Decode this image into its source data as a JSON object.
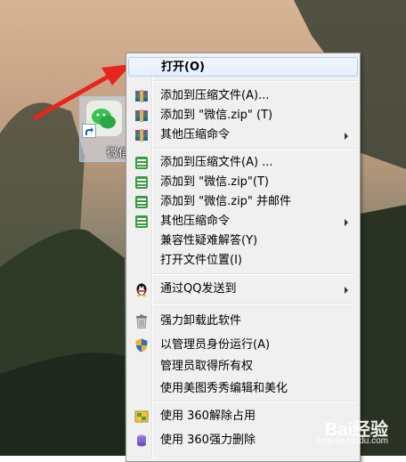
{
  "desktop": {
    "shortcut_label": "微信"
  },
  "context_menu": {
    "items": [
      {
        "label": "打开(O)",
        "icon": "none",
        "submenu": false
      },
      {
        "label": "添加到压缩文件(A)...",
        "icon": "winrar-archive-icon",
        "submenu": false
      },
      {
        "label": "添加到 \"微信.zip\" (T)",
        "icon": "winrar-archive-icon",
        "submenu": false
      },
      {
        "label": "其他压缩命令",
        "icon": "winrar-archive-icon",
        "submenu": true
      },
      {
        "label": "添加到压缩文件(A) ...",
        "icon": "archive-icon",
        "submenu": false
      },
      {
        "label": "添加到 \"微信.zip\"(T)",
        "icon": "archive-icon",
        "submenu": false
      },
      {
        "label": "添加到 \"微信.zip\" 并邮件",
        "icon": "archive-icon",
        "submenu": false
      },
      {
        "label": "其他压缩命令",
        "icon": "archive-icon",
        "submenu": true
      },
      {
        "label": "兼容性疑难解答(Y)",
        "icon": "none",
        "submenu": false
      },
      {
        "label": "打开文件位置(I)",
        "icon": "none",
        "submenu": false
      },
      {
        "label": "通过QQ发送到",
        "icon": "qq-penguin-icon",
        "submenu": true
      },
      {
        "label": "强力卸载此软件",
        "icon": "trash-icon",
        "submenu": false
      },
      {
        "label": "以管理员身份运行(A)",
        "icon": "uac-shield-icon",
        "submenu": false
      },
      {
        "label": "管理员取得所有权",
        "icon": "none",
        "submenu": false
      },
      {
        "label": "使用美图秀秀编辑和美化",
        "icon": "none",
        "submenu": false
      },
      {
        "label": "使用 360解除占用",
        "icon": "360-unlock-icon",
        "submenu": false
      },
      {
        "label": "使用 360强力删除",
        "icon": "360-delete-icon",
        "submenu": false
      }
    ]
  },
  "watermark": {
    "text": "Bai经验",
    "sub": "jingyan.baidu.com"
  }
}
